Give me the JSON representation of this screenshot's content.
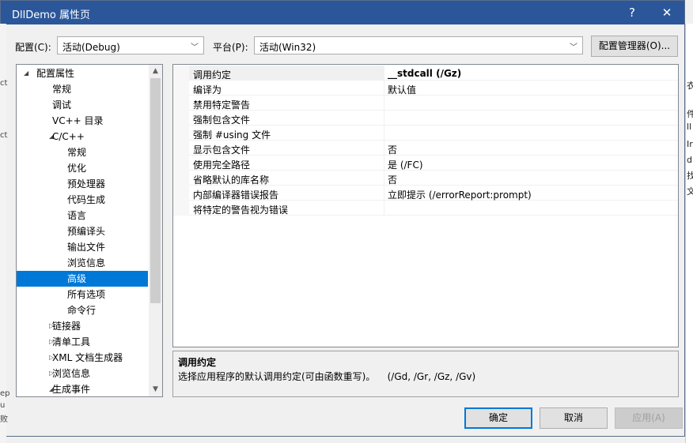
{
  "window": {
    "title": "DllDemo 属性页",
    "help_glyph": "?",
    "close_glyph": "✕"
  },
  "toolbar": {
    "config_label": "配置(C):",
    "config_value": "活动(Debug)",
    "platform_label": "平台(P):",
    "platform_value": "活动(Win32)",
    "config_manager_label": "配置管理器(O)..."
  },
  "tree": {
    "items": [
      {
        "label": "配置属性",
        "expander": "◢",
        "level": 0
      },
      {
        "label": "常规",
        "expander": "",
        "level": 1
      },
      {
        "label": "调试",
        "expander": "",
        "level": 1
      },
      {
        "label": "VC++ 目录",
        "expander": "",
        "level": 1
      },
      {
        "label": "C/C++",
        "expander": "◢",
        "level": 1
      },
      {
        "label": "常规",
        "expander": "",
        "level": 2
      },
      {
        "label": "优化",
        "expander": "",
        "level": 2
      },
      {
        "label": "预处理器",
        "expander": "",
        "level": 2
      },
      {
        "label": "代码生成",
        "expander": "",
        "level": 2
      },
      {
        "label": "语言",
        "expander": "",
        "level": 2
      },
      {
        "label": "预编译头",
        "expander": "",
        "level": 2
      },
      {
        "label": "输出文件",
        "expander": "",
        "level": 2
      },
      {
        "label": "浏览信息",
        "expander": "",
        "level": 2
      },
      {
        "label": "高级",
        "expander": "",
        "level": 2,
        "selected": true
      },
      {
        "label": "所有选项",
        "expander": "",
        "level": 2
      },
      {
        "label": "命令行",
        "expander": "",
        "level": 2
      },
      {
        "label": "链接器",
        "expander": "▷",
        "level": 1
      },
      {
        "label": "清单工具",
        "expander": "▷",
        "level": 1
      },
      {
        "label": "XML 文档生成器",
        "expander": "▷",
        "level": 1
      },
      {
        "label": "浏览信息",
        "expander": "▷",
        "level": 1
      },
      {
        "label": "生成事件",
        "expander": "◢",
        "level": 1
      }
    ]
  },
  "properties": [
    {
      "name": "调用约定",
      "value": "__stdcall (/Gz)",
      "bold": true
    },
    {
      "name": "编译为",
      "value": "默认值"
    },
    {
      "name": "禁用特定警告",
      "value": ""
    },
    {
      "name": "强制包含文件",
      "value": ""
    },
    {
      "name": "强制 #using 文件",
      "value": ""
    },
    {
      "name": "显示包含文件",
      "value": "否"
    },
    {
      "name": "使用完全路径",
      "value": "是 (/FC)"
    },
    {
      "name": "省略默认的库名称",
      "value": "否"
    },
    {
      "name": "内部编译器错误报告",
      "value": "立即提示 (/errorReport:prompt)"
    },
    {
      "name": "将特定的警告视为错误",
      "value": ""
    }
  ],
  "description": {
    "title": "调用约定",
    "text": "选择应用程序的默认调用约定(可由函数重写)。    (/Gd, /Gr, /Gz, /Gv)"
  },
  "buttons": {
    "ok": "确定",
    "cancel": "取消",
    "apply": "应用(A)"
  },
  "background_fragments": {
    "right": [
      "衣",
      "件",
      "ll",
      "Ir",
      "d",
      "找",
      "文"
    ],
    "left": [
      "ct",
      "ct",
      "ep",
      "u",
      "败"
    ]
  }
}
